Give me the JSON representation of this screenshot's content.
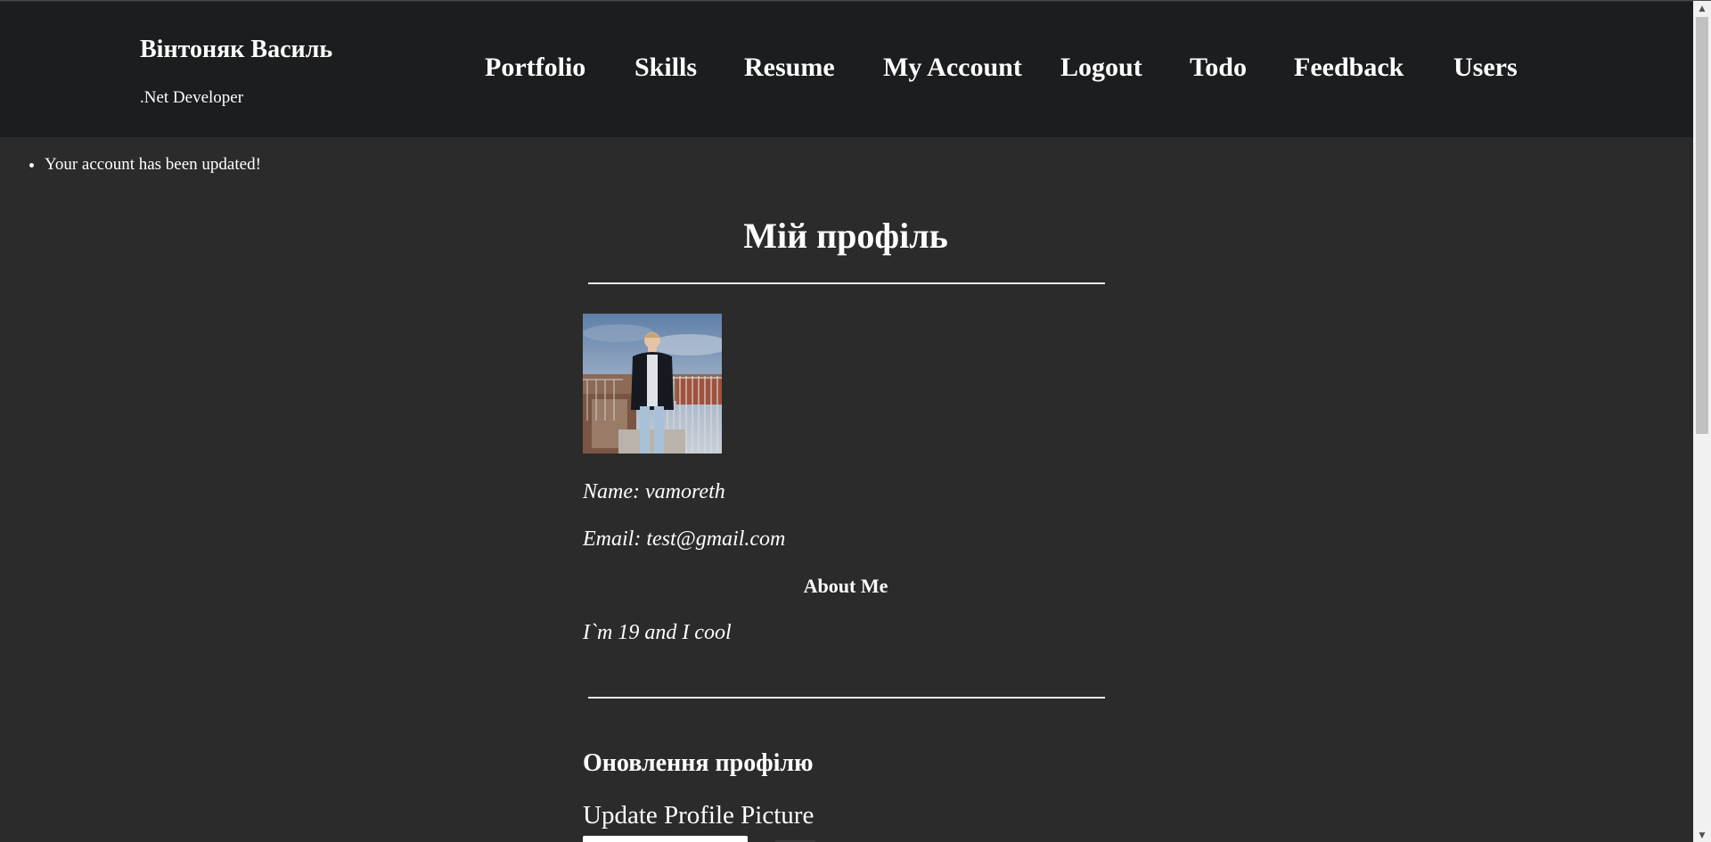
{
  "header": {
    "brand_name": "Вінтоняк Василь",
    "brand_subtitle": ".Net Developer",
    "nav": [
      {
        "label": "Portfolio"
      },
      {
        "label": "Skills"
      },
      {
        "label": "Resume"
      },
      {
        "label": "My Account"
      },
      {
        "label": "Logout"
      },
      {
        "label": "Todo"
      },
      {
        "label": "Feedback"
      },
      {
        "label": "Users"
      }
    ]
  },
  "messages": [
    "Your account has been updated!"
  ],
  "profile": {
    "title": "Мій профіль",
    "name_line": "Name: vamoreth",
    "email_line": "Email: test@gmail.com",
    "about_heading": "About Me",
    "about_text": "I`m 19 and I cool"
  },
  "update_form": {
    "heading": "Оновлення профілю",
    "picture_label": "Update Profile Picture"
  },
  "colors": {
    "page_background": "#2b2b2b",
    "header_background": "#1c1d1f",
    "text": "#ffffff"
  }
}
